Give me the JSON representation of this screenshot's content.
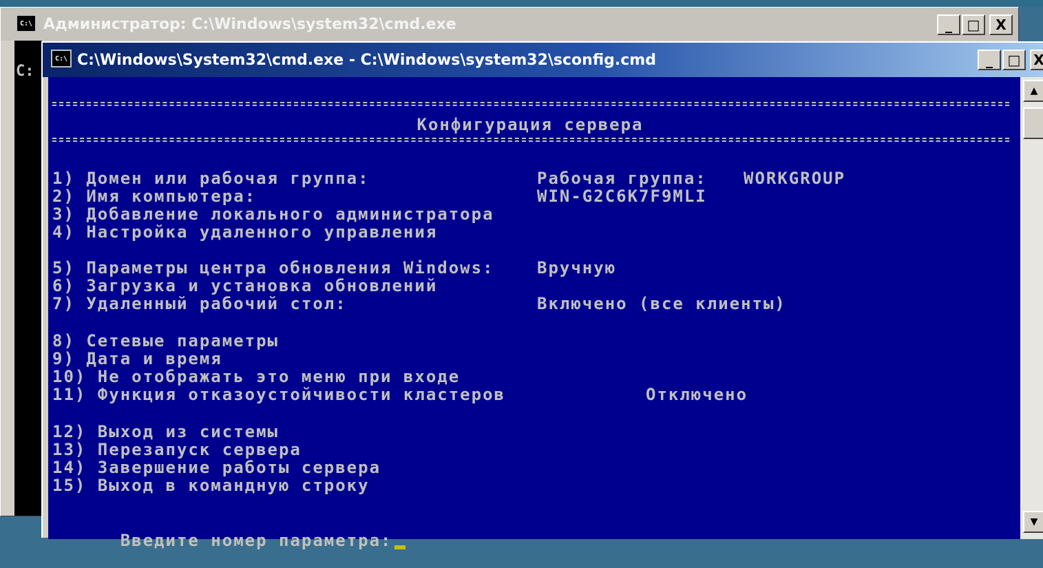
{
  "background_window": {
    "title": "Администратор: C:\\Windows\\system32\\cmd.exe",
    "console_prompt": "C:",
    "buttons": {
      "minimize": "_",
      "maximize": "□",
      "close": "X"
    }
  },
  "foreground_window": {
    "title": "C:\\Windows\\System32\\cmd.exe - C:\\Windows\\system32\\sconfig.cmd",
    "buttons": {
      "minimize": "_",
      "maximize": "□",
      "close": "X"
    }
  },
  "console": {
    "header": "Конфигурация сервера",
    "items": [
      {
        "label": "1) Домен или рабочая группа:",
        "value_label": "Рабочая группа:",
        "value": "WORKGROUP"
      },
      {
        "label": "2) Имя компьютера:",
        "value": "WIN-G2C6K7F9MLI"
      },
      {
        "label": "3) Добавление локального администратора"
      },
      {
        "label": "4) Настройка удаленного управления"
      },
      {
        "label": "5) Параметры центра обновления Windows:",
        "value": "Вручную"
      },
      {
        "label": "6) Загрузка и установка обновлений"
      },
      {
        "label": "7) Удаленный рабочий стол:",
        "value": "Включено (все клиенты)"
      },
      {
        "label": "8) Сетевые параметры"
      },
      {
        "label": "9) Дата и время"
      },
      {
        "label": "10) Не отображать это меню при входе"
      },
      {
        "label": "11) Функция отказоустойчивости кластеров",
        "value": "Отключено"
      },
      {
        "label": "12) Выход из системы"
      },
      {
        "label": "13) Перезапуск сервера"
      },
      {
        "label": "14) Завершение работы сервера"
      },
      {
        "label": "15) Выход в командную строку"
      }
    ],
    "prompt": "Введите номер параметра:"
  },
  "colors": {
    "console_bg": "#00008e",
    "console_fg": "#c0c0c0",
    "cursor": "#c0c000"
  },
  "icons": [
    "cmd-icon",
    "minimize-icon",
    "maximize-icon",
    "close-icon",
    "scroll-up-icon",
    "scroll-down-icon"
  ]
}
